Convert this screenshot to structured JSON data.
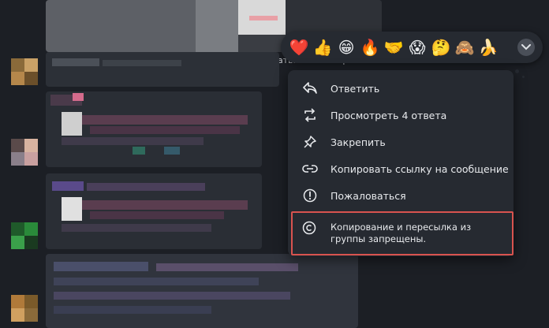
{
  "chat": {
    "caption_fragment": "атьи на монстрах"
  },
  "reactions": {
    "items": [
      {
        "emoji": "❤️",
        "icon": "heart-icon"
      },
      {
        "emoji": "👍",
        "icon": "thumbs-up-icon"
      },
      {
        "emoji": "😁",
        "icon": "grin-icon"
      },
      {
        "emoji": "🔥",
        "icon": "fire-icon"
      },
      {
        "emoji": "🤝",
        "icon": "handshake-icon"
      },
      {
        "emoji": "😱",
        "icon": "scream-icon"
      },
      {
        "emoji": "🤔",
        "icon": "thinking-icon"
      },
      {
        "emoji": "🙈",
        "icon": "see-no-evil-monkey-icon"
      },
      {
        "emoji": "🍌",
        "icon": "banana-icon"
      }
    ],
    "expand_icon": "chevron-down-icon"
  },
  "menu": {
    "reply": "Ответить",
    "view_replies": "Просмотреть 4 ответа",
    "pin": "Закрепить",
    "copy_link": "Копировать ссылку на сообщение",
    "report": "Пожаловаться",
    "restricted_notice": "Копирование и пересылка из группы запрещены."
  },
  "colors": {
    "menu_bg": "#262a31",
    "highlight_border": "#d9534f",
    "text": "#e8eaed"
  }
}
